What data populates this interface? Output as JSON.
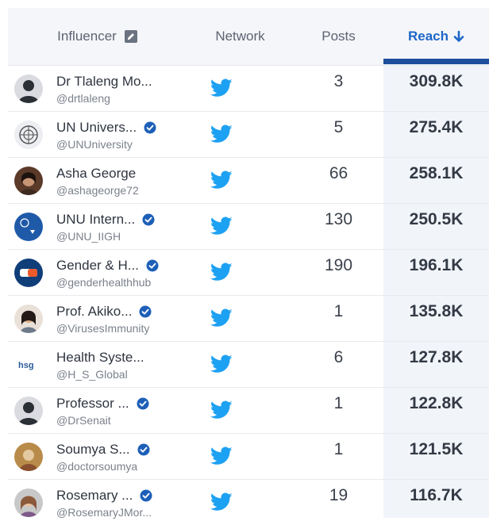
{
  "header": {
    "influencer_label": "Influencer",
    "network_label": "Network",
    "posts_label": "Posts",
    "reach_label": "Reach",
    "influencer_icon": "edit-icon",
    "reach_sort_icon": "arrow-down-icon"
  },
  "colors": {
    "accent": "#1d67c6",
    "twitter": "#1da1f2",
    "verified": "#1d5fb8",
    "header_bg": "#f5f6fa",
    "reach_bg": "#f1f4f9"
  },
  "rows": [
    {
      "name": "Dr Tlaleng Mo...",
      "handle": "@drtlaleng",
      "verified": false,
      "network": "twitter-icon",
      "posts": "3",
      "reach": "309.8K"
    },
    {
      "name": "UN Univers...",
      "handle": "@UNUniversity",
      "verified": true,
      "network": "twitter-icon",
      "posts": "5",
      "reach": "275.4K"
    },
    {
      "name": "Asha George",
      "handle": "@ashageorge72",
      "verified": false,
      "network": "twitter-icon",
      "posts": "66",
      "reach": "258.1K"
    },
    {
      "name": "UNU Intern...",
      "handle": "@UNU_IIGH",
      "verified": true,
      "network": "twitter-icon",
      "posts": "130",
      "reach": "250.5K"
    },
    {
      "name": "Gender & H...",
      "handle": "@genderhealthhub",
      "verified": true,
      "network": "twitter-icon",
      "posts": "190",
      "reach": "196.1K"
    },
    {
      "name": "Prof. Akiko...",
      "handle": "@VirusesImmunity",
      "verified": true,
      "network": "twitter-icon",
      "posts": "1",
      "reach": "135.8K"
    },
    {
      "name": "Health Syste...",
      "handle": "@H_S_Global",
      "verified": false,
      "network": "twitter-icon",
      "posts": "6",
      "reach": "127.8K"
    },
    {
      "name": "Professor ...",
      "handle": "@DrSenait",
      "verified": true,
      "network": "twitter-icon",
      "posts": "1",
      "reach": "122.8K"
    },
    {
      "name": "Soumya S...",
      "handle": "@doctorsoumya",
      "verified": true,
      "network": "twitter-icon",
      "posts": "1",
      "reach": "121.5K"
    },
    {
      "name": "Rosemary ...",
      "handle": "@RosemaryJMor...",
      "verified": true,
      "network": "twitter-icon",
      "posts": "19",
      "reach": "116.7K"
    }
  ]
}
